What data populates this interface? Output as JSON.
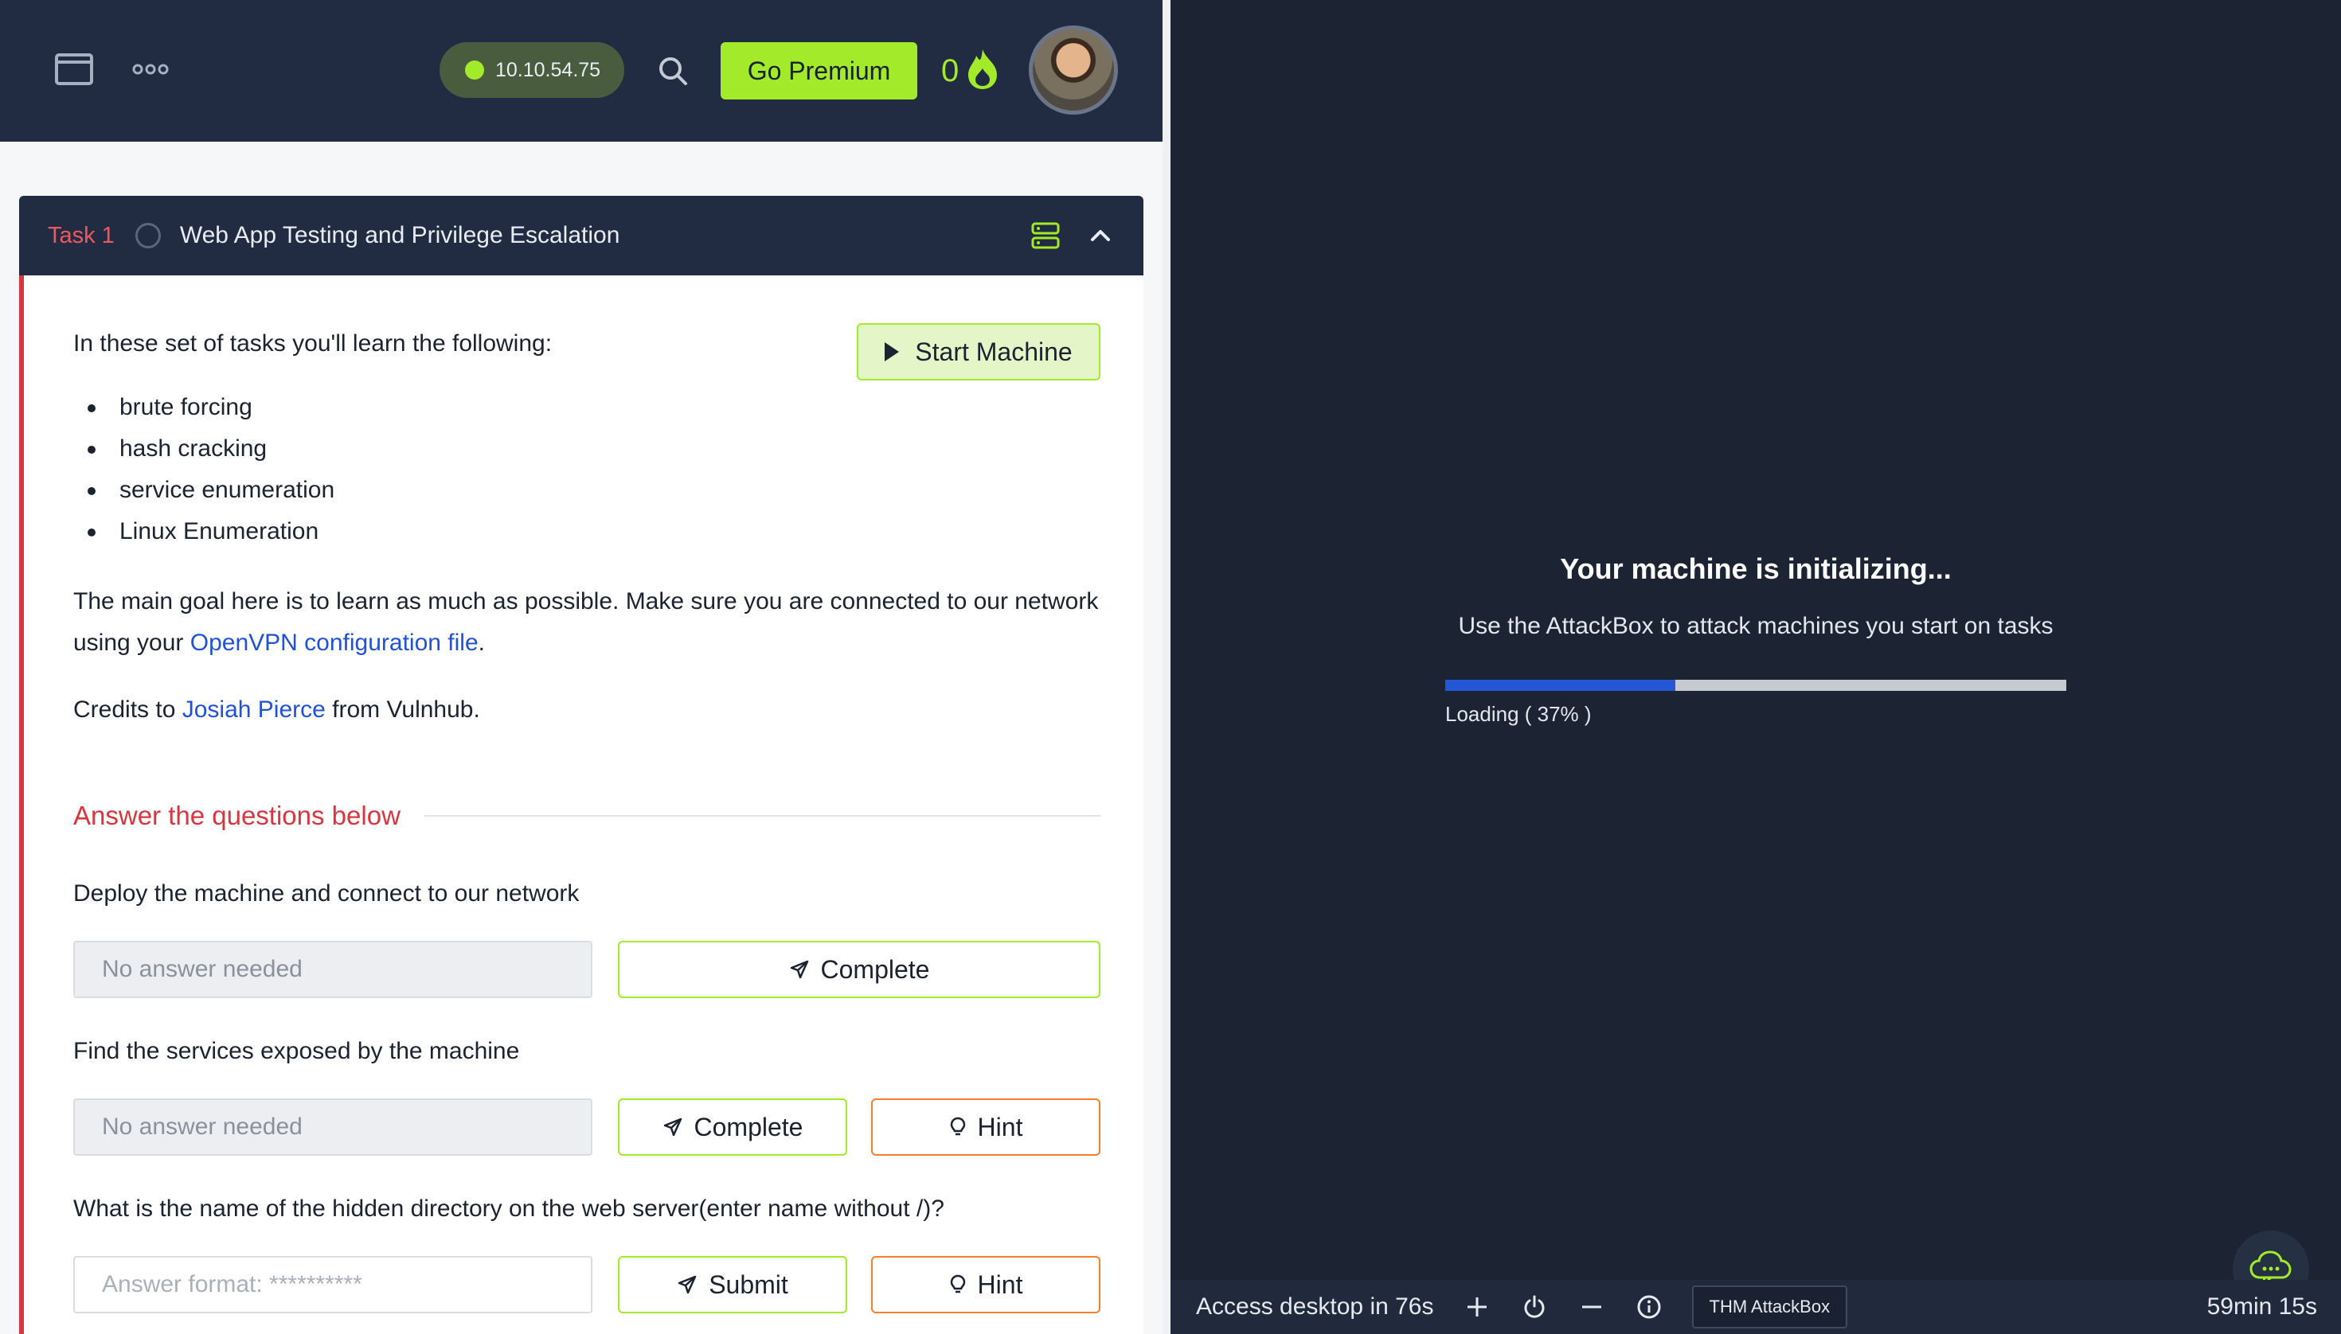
{
  "topbar": {
    "ip_address": "10.10.54.75",
    "premium_label": "Go Premium",
    "streak_count": "0",
    "icons": [
      "window-icon",
      "more-icon",
      "search-icon",
      "flame-icon"
    ]
  },
  "task": {
    "label": "Task 1",
    "title": "Web App Testing and Privilege Escalation",
    "start_machine_label": "Start Machine",
    "intro": "In these set of tasks you'll learn the following:",
    "bullets": [
      "brute forcing",
      "hash cracking",
      "service enumeration",
      "Linux Enumeration"
    ],
    "goal_line1": "The main goal here is to learn as much as possible. Make sure you are connected to our network",
    "goal_prefix": "using your ",
    "goal_link": "OpenVPN configuration file",
    "goal_suffix": ".",
    "credits_prefix": "Credits to ",
    "credits_link": "Josiah Pierce",
    "credits_suffix": " from Vulnhub.",
    "answer_heading": "Answer the questions below",
    "questions": [
      {
        "text": "Deploy the machine and connect to our network",
        "placeholder": "No answer needed",
        "action_label": "Complete"
      },
      {
        "text": "Find the services exposed by the machine",
        "placeholder": "No answer needed",
        "action_label": "Complete",
        "hint_label": "Hint"
      },
      {
        "text": "What is the name of the hidden directory on the web server(enter name without /)?",
        "placeholder": "Answer format: **********",
        "action_label": "Submit",
        "hint_label": "Hint"
      }
    ]
  },
  "machine": {
    "title": "Your machine is initializing...",
    "subtitle": "Use the AttackBox to attack machines you start on tasks",
    "loading_text": "Loading ( 37% )",
    "progress": 0.37
  },
  "bottombar": {
    "access_text": "Access desktop in 76s",
    "attackbox_label": "THM AttackBox",
    "timer": "59min 15s"
  },
  "colors": {
    "navy": "#212c42",
    "accent_green": "#a3ea2a",
    "task_red": "#d9353f",
    "link_blue": "#2052d8",
    "hint_orange": "#f57f2a",
    "progress_blue": "#2457d6"
  }
}
